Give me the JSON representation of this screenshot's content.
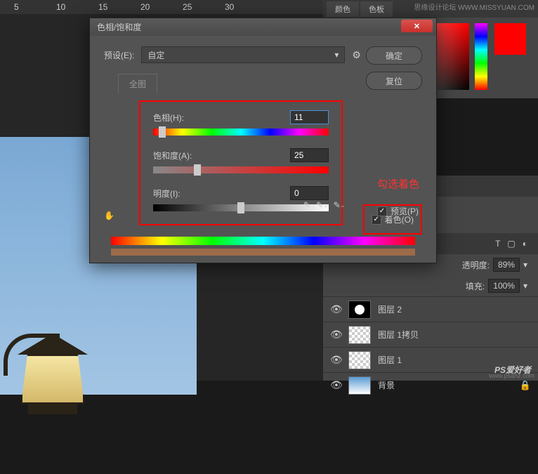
{
  "ruler": [
    "5",
    "10",
    "15",
    "20",
    "25",
    "30"
  ],
  "top_tabs": [
    "颜色",
    "色板"
  ],
  "dialog": {
    "title": "色相/饱和度",
    "preset_label": "预设(E):",
    "preset_value": "自定",
    "ok": "确定",
    "reset": "复位",
    "tab_all": "全图",
    "hue_label": "色相(H):",
    "hue_value": "11",
    "sat_label": "饱和度(A):",
    "sat_value": "25",
    "light_label": "明度(I):",
    "light_value": "0",
    "colorize": "着色(O)",
    "preview": "预览(P)"
  },
  "annotation": "勾选着色",
  "layers_panel": {
    "opacity_label": "透明度:",
    "opacity_value": "89%",
    "fill_label": "填充:",
    "fill_value": "100%",
    "layers": [
      {
        "name": "图层 2",
        "thumb": "mask",
        "locked": false
      },
      {
        "name": "图层 1拷贝",
        "thumb": "checker",
        "locked": false
      },
      {
        "name": "图层 1",
        "thumb": "checker",
        "locked": false
      },
      {
        "name": "背景",
        "thumb": "adjust",
        "locked": true
      }
    ]
  },
  "watermark_top": "思缘设计论坛 WWW.MISSYUAN.COM",
  "brand": "PS",
  "brand_sub": "爱好者",
  "url": "www.psahz.com"
}
